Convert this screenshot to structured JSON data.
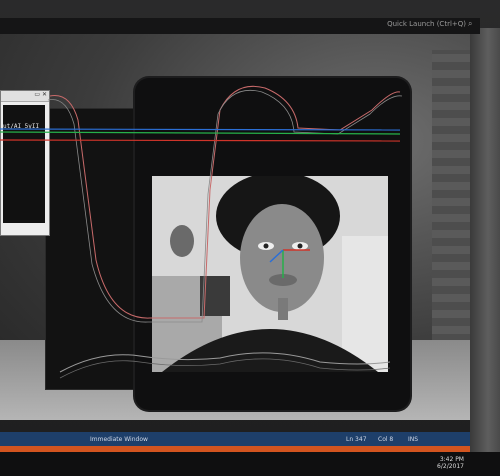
{
  "header": {
    "quick_launch_label": "Quick Launch (Ctrl+Q)",
    "quick_launch_icon": "search-icon"
  },
  "console_window": {
    "title_controls": "▭ ✕",
    "text": "ut/AI_5yII"
  },
  "status": {
    "label": "Immediate Window",
    "right_a": "Ln 347",
    "right_b": "Col 8",
    "right_c": "INS"
  },
  "taskbar": {
    "time": "3:42 PM",
    "date": "6/2/2017"
  },
  "colors": {
    "status_blue": "#1e3f6a",
    "status_orange": "#d2541f",
    "axis_red": "#d0342a",
    "axis_green": "#26b04a",
    "axis_blue": "#2b6fd6"
  }
}
